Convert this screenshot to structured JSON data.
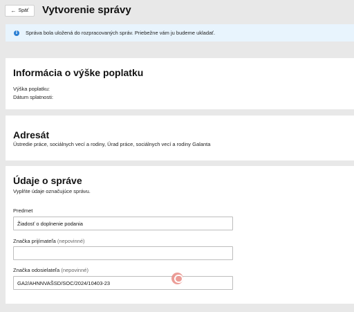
{
  "header": {
    "back_label": "Späť",
    "title": "Vytvorenie správy"
  },
  "banner": {
    "text": "Správa bola uložená do rozpracovaných správ. Priebežne vám ju budeme ukladať."
  },
  "fee": {
    "title": "Informácia o výške poplatku",
    "amount_label": "Výška poplatku:",
    "due_label": "Dátum splatnosti:"
  },
  "recipient": {
    "title": "Adresát",
    "value": "Ústredie práce, sociálnych vecí a rodiny, Úrad práce, sociálnych vecí a rodiny Galanta"
  },
  "message": {
    "title": "Údaje o správe",
    "subtitle": "Vyplňte údaje označujúce správu.",
    "subject_label": "Predmet",
    "subject_value": "Žiadosť o doplnenie podania",
    "recipient_ref_label": "Značka prijímateľa",
    "recipient_ref_optional": "(nepovinné)",
    "recipient_ref_value": "",
    "sender_ref_label": "Značka odosielateľa",
    "sender_ref_optional": "(nepovinné)",
    "sender_ref_value": "GA2/AHNNVAŠSD/SOC/2024/10403-23"
  },
  "colors": {
    "banner_bg": "#e8f4fd",
    "info_icon": "#2a7fd4",
    "page_bg": "#e8e8e8"
  }
}
